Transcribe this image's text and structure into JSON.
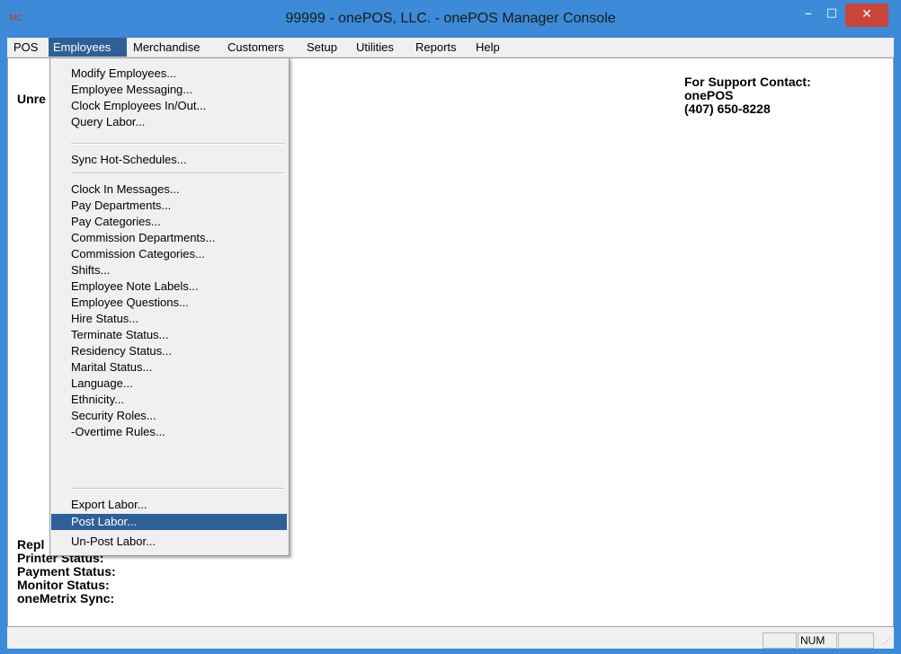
{
  "window": {
    "icon_text": "MC",
    "title": "99999 - onePOS, LLC. - onePOS Manager Console",
    "minimize": "–",
    "maximize": "□",
    "close": "✕"
  },
  "menubar": [
    "POS",
    "Employees",
    "Merchandise",
    "Customers",
    "Setup",
    "Utilities",
    "Reports",
    "Help"
  ],
  "content": {
    "partial_label_top": "Unre",
    "support_heading": "For Support Contact:",
    "support_company": "onePOS",
    "support_phone": "(407) 650-8228",
    "partial_label_bottom": "Repl",
    "printer_status": "Printer Status:",
    "payment_status": "Payment Status:",
    "monitor_status": "Monitor Status:",
    "onemetrix_sync": "oneMetrix Sync:"
  },
  "employees_menu": {
    "group1": [
      "Modify Employees...",
      "Employee Messaging...",
      "Clock Employees In/Out...",
      "Query Labor..."
    ],
    "group2": [
      "Sync Hot-Schedules..."
    ],
    "group3": [
      "Clock In Messages...",
      "Pay Departments...",
      "Pay Categories...",
      "Commission Departments...",
      "Commission Categories...",
      "Shifts...",
      "Employee Note Labels...",
      "Employee Questions...",
      "Hire Status...",
      "Terminate Status...",
      "Residency Status...",
      "Marital Status...",
      "Language...",
      "Ethnicity...",
      "Security Roles...",
      "-Overtime Rules..."
    ],
    "group4": [
      "Export Labor...",
      "Post Labor...",
      "Un-Post Labor..."
    ],
    "highlighted": "Post Labor..."
  },
  "statusbar": {
    "num": "NUM"
  },
  "colors": {
    "title_bg": "#3d8ad8",
    "highlight": "#2f5f97",
    "close_btn": "#c9453a"
  }
}
